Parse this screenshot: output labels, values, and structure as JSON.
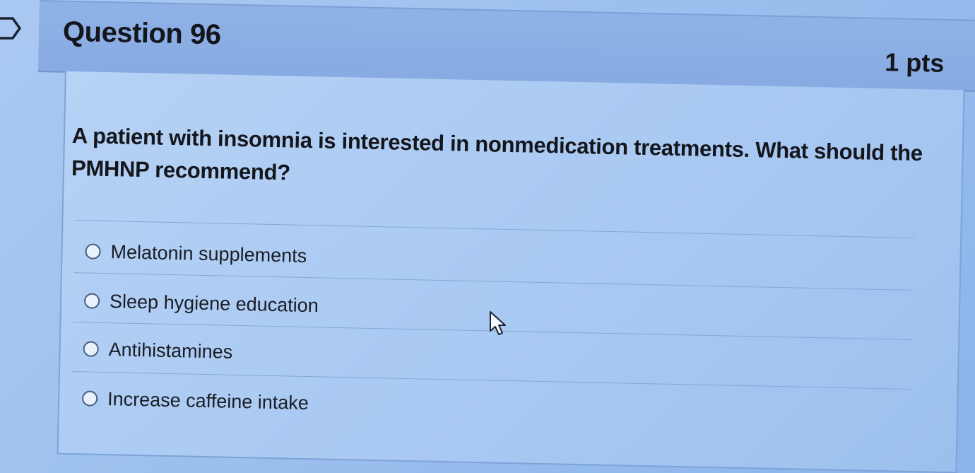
{
  "question": {
    "title": "Question 96",
    "points": "1 pts",
    "text": "A patient with insomnia is interested in nonmedication treatments. What should the PMHNP recommend?"
  },
  "answers": [
    {
      "label": "Melatonin supplements",
      "selected": false
    },
    {
      "label": "Sleep hygiene education",
      "selected": false
    },
    {
      "label": "Antihistamines",
      "selected": false
    },
    {
      "label": "Increase caffeine intake",
      "selected": false
    }
  ],
  "icons": {
    "flag": "flag-icon",
    "cursor": "mouse-pointer-icon"
  },
  "colors": {
    "header_bg": "#8fb2e6",
    "body_bg": "#a7c8f2",
    "text": "#14161c"
  }
}
